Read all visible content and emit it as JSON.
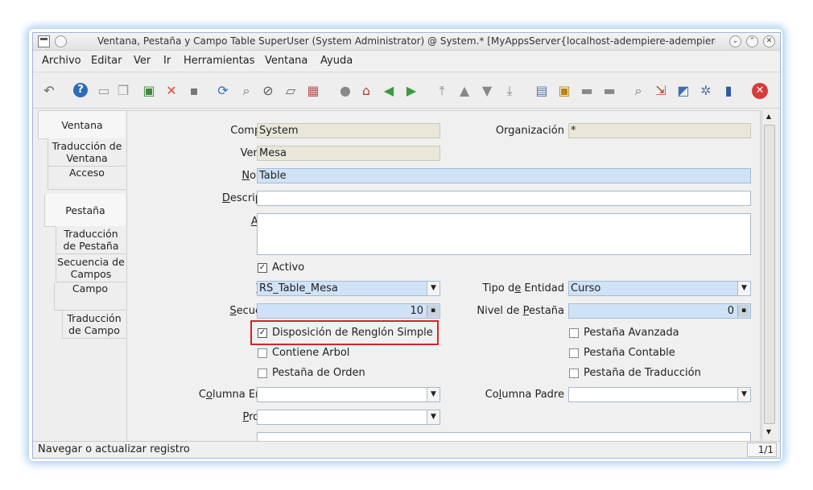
{
  "window": {
    "title": "Ventana, Pestaña y Campo  Table  SuperUser (System Administrator) @ System.* [MyAppsServer{localhost-adempiere-adempiere}]"
  },
  "menu": [
    "Archivo",
    "Editar",
    "Ver",
    "Ir",
    "Herramientas",
    "Ventana",
    "Ayuda"
  ],
  "tabs": [
    "Ventana",
    "Traducción de Ventana",
    "Acceso",
    "Pestaña",
    "Traducción de Pestaña",
    "Secuencia de Campos",
    "Campo",
    "Traducción de Campo"
  ],
  "form": {
    "compania": {
      "label": "Compañía",
      "value": "System"
    },
    "organizacion": {
      "label": "Organización",
      "value": "*"
    },
    "ventana": {
      "label": "Ventana",
      "value": "Mesa"
    },
    "nombre": {
      "label": "Nombre",
      "value": "Table"
    },
    "descripcion": {
      "label": "Descripción",
      "value": ""
    },
    "ayuda": {
      "label": "Ayuda",
      "value": ""
    },
    "activo": {
      "label": "Activo",
      "checked": true
    },
    "tabla": {
      "label": "Tabla",
      "value": "RS_Table_Mesa"
    },
    "tipo_entidad": {
      "label": "Tipo de Entidad",
      "value": "Curso"
    },
    "secuencia": {
      "label": "Secuencia",
      "value": "10"
    },
    "nivel_pestana": {
      "label": "Nivel de Pestaña",
      "value": "0"
    },
    "disposicion": {
      "label": "Disposición de Renglón Simple",
      "checked": true
    },
    "pestana_avanzada": {
      "label": "Pestaña Avanzada",
      "checked": false
    },
    "contiene_arbol": {
      "label": "Contiene Arbol",
      "checked": false
    },
    "pestana_contable": {
      "label": "Pestaña Contable",
      "checked": false
    },
    "pestana_orden": {
      "label": "Pestaña de Orden",
      "checked": false
    },
    "pestana_traduccion": {
      "label": "Pestaña de Traducción",
      "checked": false
    },
    "columna_enlace": {
      "label": "Columna Enlace",
      "value": ""
    },
    "columna_padre": {
      "label": "Columna Padre",
      "value": ""
    },
    "proceso": {
      "label": "Proceso",
      "value": ""
    }
  },
  "status": {
    "message": "Navegar o actualizar registro",
    "page": "1/1"
  },
  "colors": {
    "mandatory": "#d0e2f6",
    "readonly": "#e8e7da",
    "highlight": "#d0272b"
  }
}
